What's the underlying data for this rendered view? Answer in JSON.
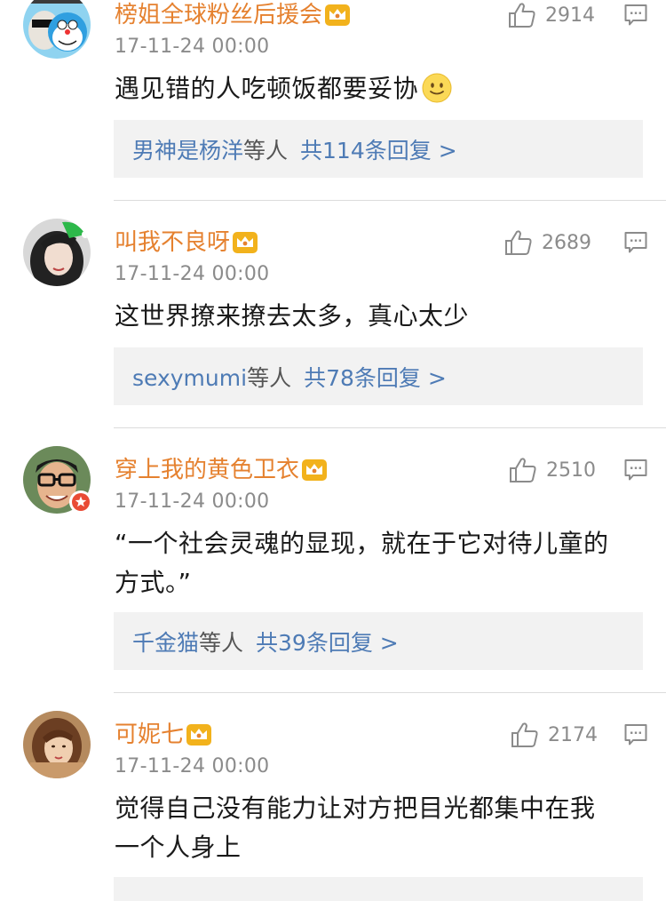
{
  "comments": [
    {
      "username": "榜姐全球粉丝后援会",
      "timestamp": "17-11-24 00:00",
      "likes": "2914",
      "content": "遇见错的人吃顿饭都要妥协",
      "emoji_icon": "smile-icon",
      "replies": {
        "names": "男神是杨洋",
        "others": "等人",
        "count_text": "共114条回复 >"
      }
    },
    {
      "username": "叫我不良呀",
      "timestamp": "17-11-24 00:00",
      "likes": "2689",
      "content": "这世界撩来撩去太多，真心太少",
      "replies": {
        "names": "sexymumi",
        "others": "等人",
        "count_text": "共78条回复 >"
      }
    },
    {
      "username": "穿上我的黄色卫衣",
      "timestamp": "17-11-24 00:00",
      "likes": "2510",
      "content_line1": "“一个社会灵魂的显现，就在于它对待儿童的",
      "content_line2": "方式。”",
      "replies": {
        "names": "千金猫",
        "others": "等人",
        "count_text": "共39条回复 >"
      }
    },
    {
      "username": "可妮七",
      "timestamp": "17-11-24 00:00",
      "likes": "2174",
      "content_line1": "觉得自己没有能力让对方把目光都集中在我",
      "content_line2": "一个人身上",
      "replies": {
        "names": "",
        "others": "",
        "count_text": ""
      }
    }
  ],
  "colors": {
    "username": "#e5812f",
    "reply_link": "#4e7bb5",
    "meta_gray": "#8b8b8b",
    "reply_bg": "#f2f2f2",
    "crown_gold": "#f2b21c"
  },
  "icons": {
    "like": "thumb-up-icon",
    "reply": "comment-icon",
    "vip": "crown-icon",
    "verified": "verified-badge-icon"
  }
}
